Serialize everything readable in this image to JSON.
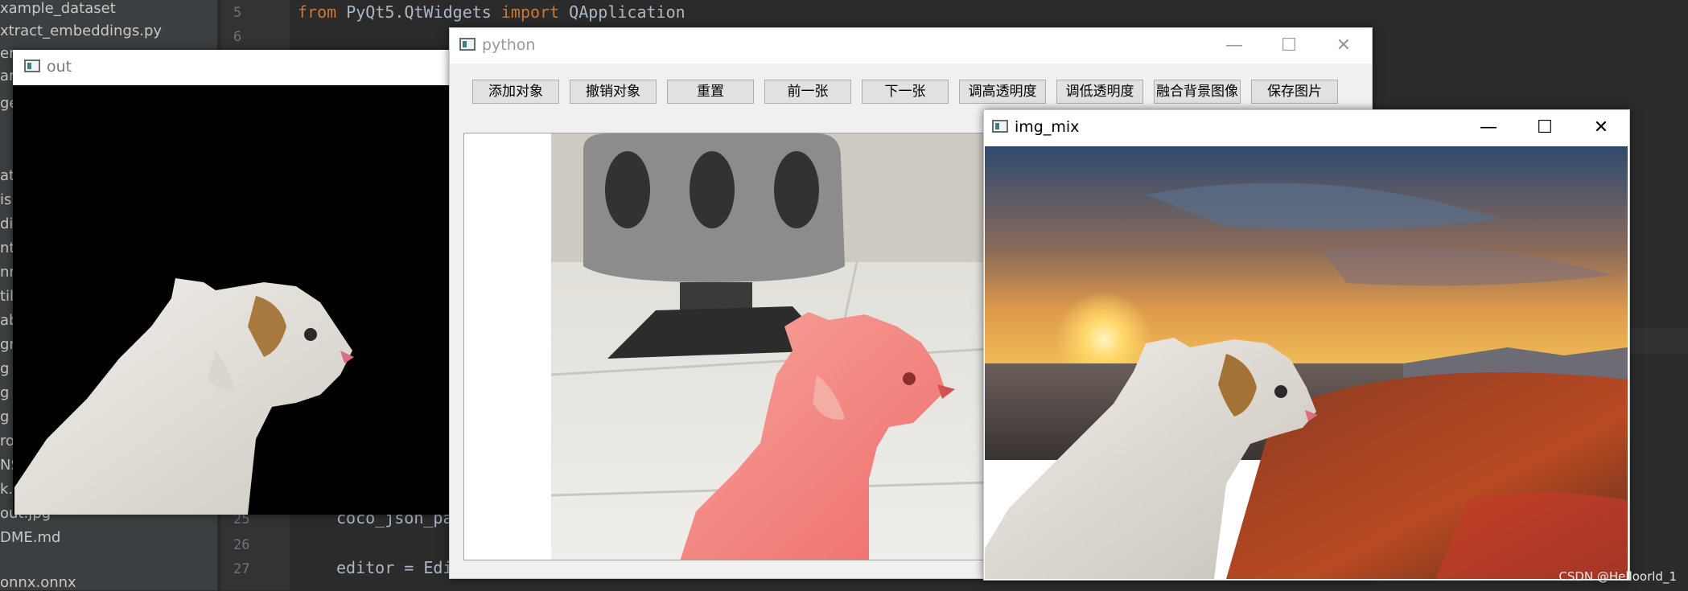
{
  "ide": {
    "project_items": [
      "xample_dataset",
      "xtract_embeddings.py",
      "er",
      "am",
      "ge",
      "at",
      "isp",
      "dit",
      "nte",
      "nn",
      "til",
      "ab",
      "gn",
      "g",
      "g",
      "g",
      "ro",
      "NS",
      "k.j",
      "out.jpg",
      "DME.md",
      "",
      "onnx.onnx"
    ],
    "line_numbers": [
      "5",
      "6",
      "25",
      "26",
      "27"
    ],
    "code": {
      "line5_kw1": "from",
      "line5_mod": " PyQt5.QtWidgets ",
      "line5_kw2": "import",
      "line5_name": " QApplication",
      "line25": "coco_json_pa",
      "line27": "editor = Edi"
    }
  },
  "win_out": {
    "title": "out"
  },
  "win_python": {
    "title": "python",
    "controls": {
      "minimize": "—",
      "maximize": "☐",
      "close": "✕"
    },
    "toolbar_buttons": [
      "添加对象",
      "撤销对象",
      "重置",
      "前一张",
      "下一张",
      "调高透明度",
      "调低透明度",
      "融合背景图像",
      "保存图片"
    ]
  },
  "win_mix": {
    "title": "img_mix",
    "controls": {
      "minimize": "—",
      "maximize": "☐",
      "close": "✕"
    }
  },
  "watermark": "CSDN @Helloorld_1",
  "colors": {
    "ide_bg": "#2b2b2b",
    "keyword": "#cc7832",
    "mask_overlay": "#f26d6d",
    "window_chrome": "#ffffff",
    "button_bg": "#e1e1e1"
  },
  "icons": {
    "app": "python-app-icon",
    "minimize": "minimize-icon",
    "maximize": "maximize-icon",
    "close": "close-icon"
  }
}
